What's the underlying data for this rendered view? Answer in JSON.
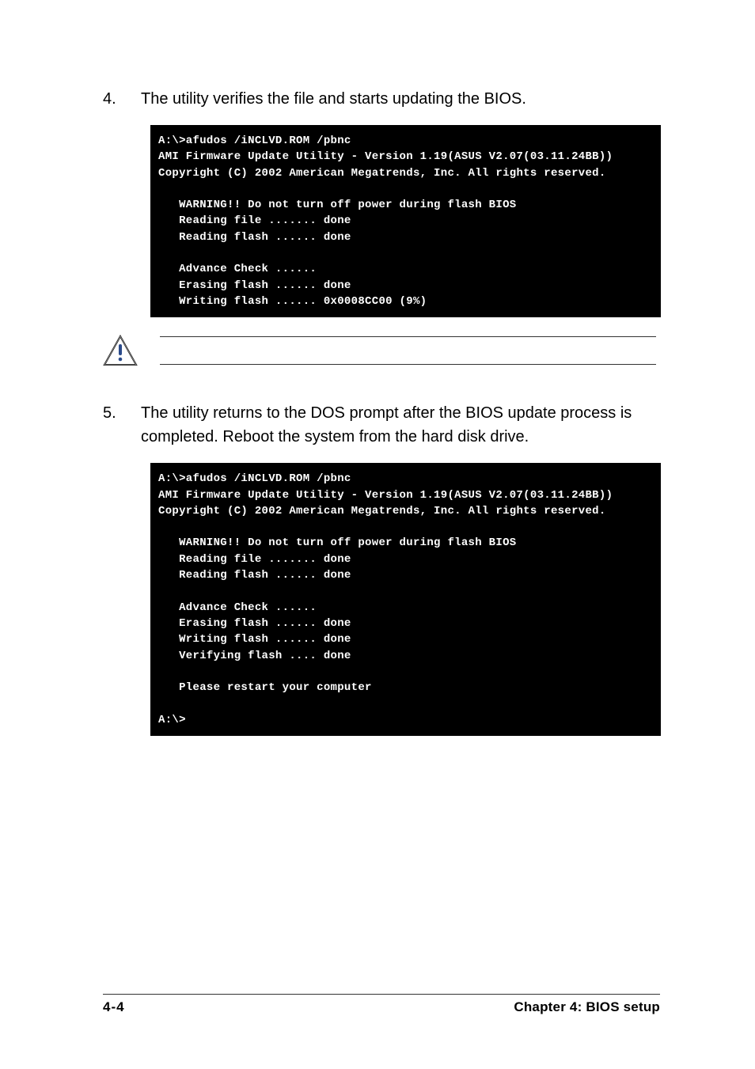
{
  "steps": {
    "s4": {
      "num": "4.",
      "text": "The utility verifies the file and starts updating the BIOS."
    },
    "s5": {
      "num": "5.",
      "text": "The utility returns to the DOS prompt after the BIOS update process is completed. Reboot the system from the hard disk drive."
    }
  },
  "terminal1": {
    "l0": "A:\\>afudos /iNCLVD.ROM /pbnc",
    "l1": "AMI Firmware Update Utility - Version 1.19(ASUS V2.07(03.11.24BB))",
    "l2": "Copyright (C) 2002 American Megatrends, Inc. All rights reserved.",
    "l3": "",
    "l4": "   WARNING!! Do not turn off power during flash BIOS",
    "l5": "   Reading file ....... done",
    "l6": "   Reading flash ...... done",
    "l7": "",
    "l8": "   Advance Check ......",
    "l9": "   Erasing flash ...... done",
    "l10": "   Writing flash ...... 0x0008CC00 (9%)"
  },
  "terminal2": {
    "l0": "A:\\>afudos /iNCLVD.ROM /pbnc",
    "l1": "AMI Firmware Update Utility - Version 1.19(ASUS V2.07(03.11.24BB))",
    "l2": "Copyright (C) 2002 American Megatrends, Inc. All rights reserved.",
    "l3": "",
    "l4": "   WARNING!! Do not turn off power during flash BIOS",
    "l5": "   Reading file ....... done",
    "l6": "   Reading flash ...... done",
    "l7": "",
    "l8": "   Advance Check ......",
    "l9": "   Erasing flash ...... done",
    "l10": "   Writing flash ...... done",
    "l11": "   Verifying flash .... done",
    "l12": "",
    "l13": "   Please restart your computer",
    "l14": "",
    "l15": "A:\\>"
  },
  "footer": {
    "left": "4-4",
    "right": "Chapter 4: BIOS setup"
  }
}
